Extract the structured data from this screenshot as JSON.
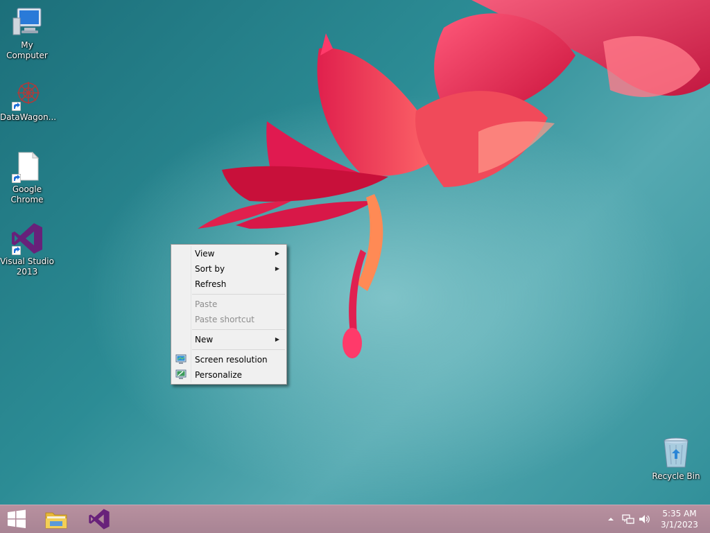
{
  "desktop": {
    "icons": [
      {
        "label": "My Computer",
        "icon": "computer-icon"
      },
      {
        "label": "DataWagon...",
        "icon": "datawagon-icon"
      },
      {
        "label": "Google\nChrome",
        "line1": "Google",
        "line2": "Chrome",
        "icon": "document-icon"
      },
      {
        "label": "Visual Studio 2013",
        "line1": "Visual Studio",
        "line2": "2013",
        "icon": "visual-studio-icon"
      },
      {
        "label": "Recycle Bin",
        "icon": "recycle-bin-icon"
      }
    ]
  },
  "context_menu": {
    "view": "View",
    "sort_by": "Sort by",
    "refresh": "Refresh",
    "paste": "Paste",
    "paste_shortcut": "Paste shortcut",
    "new": "New",
    "screen_resolution": "Screen resolution",
    "personalize": "Personalize"
  },
  "taskbar": {
    "time": "5:35 AM",
    "date": "3/1/2023"
  },
  "colors": {
    "taskbar": "#b08a9a",
    "menu_bg": "#f0f0f0",
    "vs_purple": "#68217a"
  }
}
